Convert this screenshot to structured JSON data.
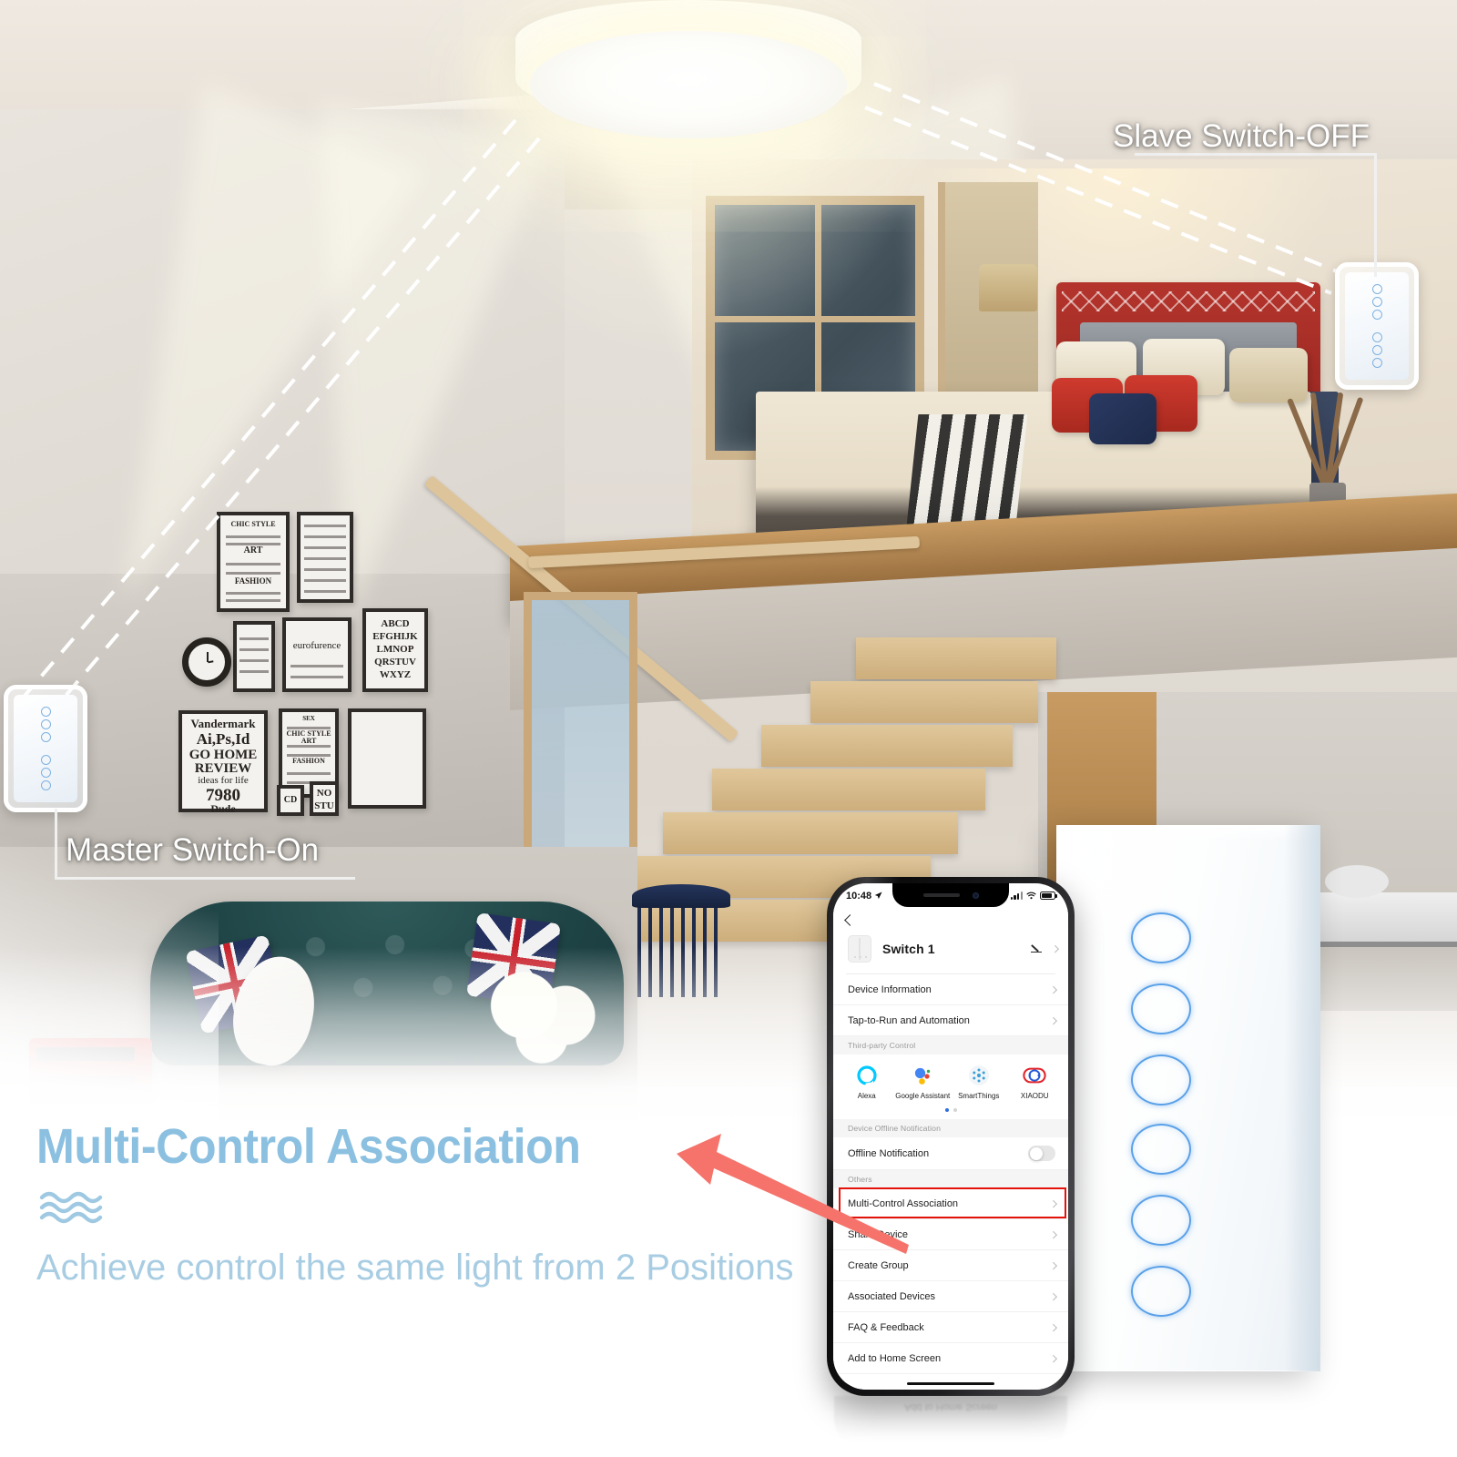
{
  "scene": {
    "ceiling_lamp": {
      "name": "round ceiling light"
    },
    "callouts": [
      {
        "id": "slave",
        "label": "Slave Switch-OFF",
        "state": "OFF"
      },
      {
        "id": "master",
        "label": "Master Switch-On",
        "state": "On"
      }
    ]
  },
  "product_switch": {
    "name": "wall touch switch panel",
    "ring_count_top": 3,
    "ring_count_bottom": 3,
    "accent": "#5aa0e8"
  },
  "phone": {
    "status_bar": {
      "time": "10:48",
      "location_icon": "location-arrow-icon",
      "signal": "signal-bars-icon",
      "wifi": "wifi-icon",
      "battery": "battery-icon"
    },
    "nav": {
      "back_icon": "chevron-left-icon"
    },
    "device": {
      "name": "Switch 1",
      "edit_icon": "pencil-icon",
      "thumb_icon": "switch-thumbnail-icon"
    },
    "menu_top": [
      {
        "label": "Device Information"
      },
      {
        "label": "Tap-to-Run and Automation"
      }
    ],
    "third_party": {
      "group_title": "Third-party Control",
      "items": [
        {
          "label": "Alexa",
          "icon": "alexa-icon"
        },
        {
          "label": "Google Assistant",
          "icon": "google-assistant-icon"
        },
        {
          "label": "SmartThings",
          "icon": "smartthings-icon"
        },
        {
          "label": "XIAODU",
          "icon": "xiaodu-icon"
        }
      ],
      "page_dots": 2,
      "active_dot": 1
    },
    "offline": {
      "group_title": "Device Offline Notification",
      "label": "Offline Notification",
      "toggle_state": "off"
    },
    "others": {
      "group_title": "Others",
      "items": [
        {
          "label": "Multi-Control Association",
          "highlighted": true
        },
        {
          "label": "Share Device",
          "highlighted": false
        },
        {
          "label": "Create Group",
          "highlighted": false
        },
        {
          "label": "Associated Devices",
          "highlighted": false
        },
        {
          "label": "FAQ & Feedback",
          "highlighted": false
        },
        {
          "label": "Add to Home Screen",
          "highlighted": false
        }
      ]
    },
    "highlight_color": "#e3120b"
  },
  "marketing": {
    "title": "Multi-Control Association",
    "subtitle": "Achieve control the same light from 2 Positions",
    "wave_icon": "wave-lines-icon",
    "title_color": "#8cc0e0",
    "subtitle_color": "#a8cde3",
    "arrow_color": "#f5736b"
  }
}
